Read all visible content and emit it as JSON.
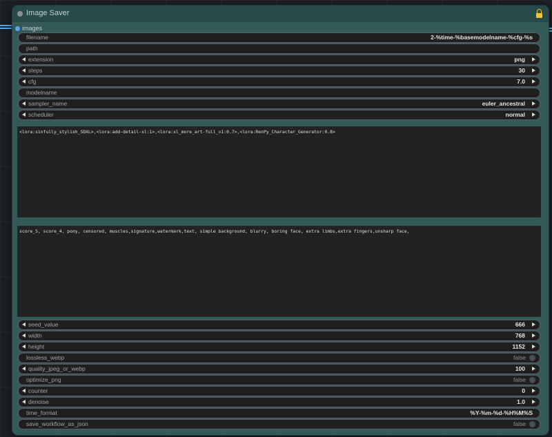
{
  "node": {
    "title": "Image Saver",
    "input_label": "images"
  },
  "widgets": [
    {
      "key": "filename",
      "label": "filename",
      "value": "2-%time-%basemodelname-%cfg-%s",
      "kind": "text"
    },
    {
      "key": "path",
      "label": "path",
      "value": "",
      "kind": "text"
    },
    {
      "key": "extension",
      "label": "extension",
      "value": "png",
      "kind": "combo"
    },
    {
      "key": "steps",
      "label": "steps",
      "value": "30",
      "kind": "combo"
    },
    {
      "key": "cfg",
      "label": "cfg",
      "value": "7.0",
      "kind": "combo"
    },
    {
      "key": "modelname",
      "label": "modelname",
      "value": "",
      "kind": "text"
    },
    {
      "key": "sampler_name",
      "label": "sampler_name",
      "value": "euler_ancestral",
      "kind": "combo"
    },
    {
      "key": "scheduler",
      "label": "scheduler",
      "value": "normal",
      "kind": "combo"
    }
  ],
  "positive_prompt": "<lora:sinfully_stylish_SDXL>,<lora:add-detail-xl:1>,<lora:xl_more_art-full_v1:0.7>,<lora:RenPy_Character_Generator:0.8>",
  "negative_prompt": "score_5, score_4, pony, censored, muscles,signature,watermark,text, simple background, blurry, boring face, extra limbs,extra fingers,unsharp face,",
  "widgets_bottom": [
    {
      "key": "seed_value",
      "label": "seed_value",
      "value": "666",
      "kind": "combo"
    },
    {
      "key": "width",
      "label": "width",
      "value": "768",
      "kind": "combo"
    },
    {
      "key": "height",
      "label": "height",
      "value": "1152",
      "kind": "combo"
    },
    {
      "key": "lossless_webp",
      "label": "lossless_webp",
      "value": "false",
      "kind": "toggle"
    },
    {
      "key": "quality_jpeg_or_webp",
      "label": "quality_jpeg_or_webp",
      "value": "100",
      "kind": "combo"
    },
    {
      "key": "optimize_png",
      "label": "optimize_png",
      "value": "false",
      "kind": "toggle"
    },
    {
      "key": "counter",
      "label": "counter",
      "value": "0",
      "kind": "combo"
    },
    {
      "key": "denoise",
      "label": "denoise",
      "value": "1.0",
      "kind": "combo"
    },
    {
      "key": "time_format",
      "label": "time_format",
      "value": "%Y-%m-%d-%H%M%S",
      "kind": "text"
    },
    {
      "key": "save_workflow_as_json",
      "label": "save_workflow_as_json",
      "value": "false",
      "kind": "toggle"
    }
  ],
  "colors": {
    "node_body": "#345a58",
    "node_header": "#254a47",
    "wire": "#58a6e8",
    "lock": "#f1c232"
  }
}
